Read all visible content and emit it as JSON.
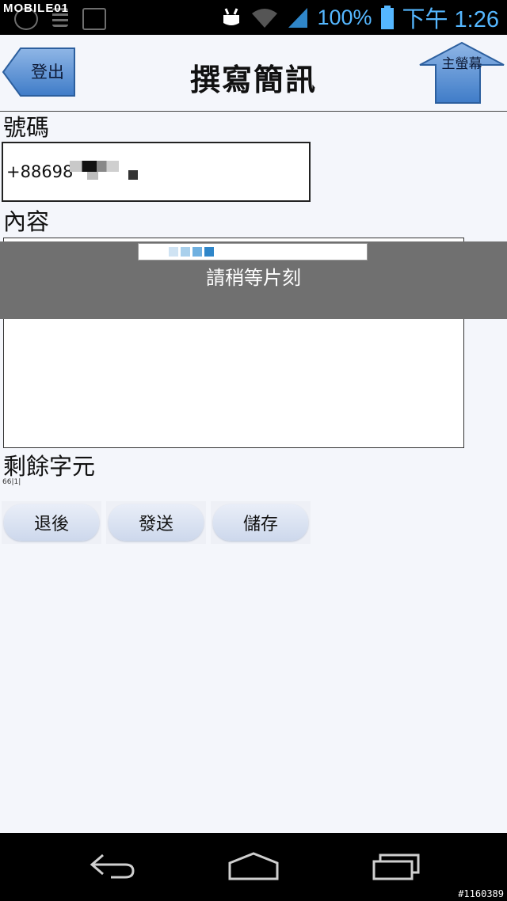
{
  "status_bar": {
    "watermark": "MOBILE01",
    "battery_percent": "100%",
    "time": "下午 1:26",
    "accent_color": "#55b7ff",
    "icons": [
      "usb-icon",
      "notification-icon",
      "photo-icon",
      "android-icon",
      "wifi-icon",
      "signal-icon",
      "battery-icon"
    ]
  },
  "header": {
    "title": "撰寫簡訊",
    "logout_label": "登出",
    "home_label": "主螢幕"
  },
  "form": {
    "number_label": "號碼",
    "number_value": "+88698",
    "content_label": "內容",
    "content_value": "",
    "remaining_label": "剩餘字元",
    "remaining_count": "66|1|"
  },
  "buttons": {
    "back": "退後",
    "send": "發送",
    "save": "儲存"
  },
  "overlay": {
    "message": "請稍等片刻",
    "progress_colors": [
      "#cfe3f3",
      "#a9d0ec",
      "#6fb0e0",
      "#2f86c9"
    ]
  },
  "nav_bar": {
    "icons": [
      "back-icon",
      "home-icon",
      "recent-apps-icon"
    ]
  },
  "image_id": "#1160389"
}
